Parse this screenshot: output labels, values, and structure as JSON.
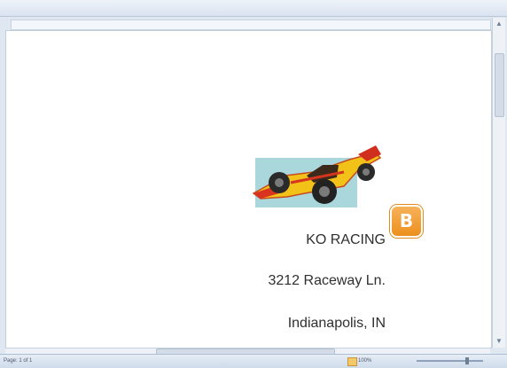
{
  "document": {
    "lines": [
      "KO RACING",
      "3212 Raceway Ln.",
      "Indianapolis, IN"
    ],
    "image": "race-car-clipart"
  },
  "callout": {
    "label": "B",
    "color": "#f0a03a"
  },
  "statusbar": {
    "left_text": "Page: 1 of 1",
    "zoom_text": "100%"
  },
  "icons": {
    "scroll_up": "triangle-up-icon",
    "scroll_down": "triangle-down-icon"
  }
}
